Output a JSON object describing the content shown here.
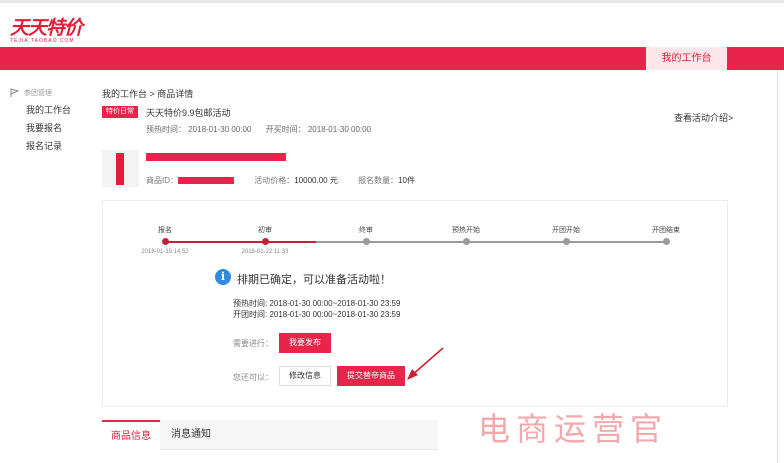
{
  "header": {
    "logo_text": "天天特价",
    "logo_sub": "TEJIA.TAOBAO.COM",
    "workbench_label": "我的工作台"
  },
  "sidebar": {
    "heading": "参团管理",
    "items": [
      {
        "label": "我的工作台"
      },
      {
        "label": "我要报名"
      },
      {
        "label": "报名记录"
      }
    ]
  },
  "breadcrumb": "我的工作台 > 商品详情",
  "activity": {
    "tag": "特价日常",
    "title": "天天特价9.9包邮活动",
    "preheat": "预热时间： 2018-01-30 00:00",
    "open": "开买时间： 2018-01-30 00:00",
    "view_link": "查看活动介绍>"
  },
  "product": {
    "id_label": "商品ID：",
    "price_label": "活动价格：",
    "price": "10000.00 元",
    "qty_label": "报名数量：",
    "qty": "10件"
  },
  "steps": [
    {
      "label": "报名",
      "time": "2018-01-19 14:52",
      "done": true
    },
    {
      "label": "初审",
      "time": "2018-01-22 11:33",
      "done": true
    },
    {
      "label": "终审",
      "time": "",
      "done": false
    },
    {
      "label": "预热开始",
      "time": "",
      "done": false
    },
    {
      "label": "开团开始",
      "time": "",
      "done": false
    },
    {
      "label": "开团结束",
      "time": "",
      "done": false
    }
  ],
  "status": {
    "message": "排期已确定，可以准备活动啦！",
    "preheat_line": "预热时间: 2018-01-30 00:00~2018-01-30 23:59",
    "open_line": "开团时间: 2018-01-30 00:00~2018-01-30 23:59"
  },
  "actions": {
    "need_label": "需要进行：",
    "publish_button": "我要发布",
    "also_label": "您还可以：",
    "edit_button": "修改信息",
    "substitute_button": "提交替帝商品"
  },
  "tabs": [
    {
      "label": "商品信息"
    },
    {
      "label": "消息通知"
    }
  ],
  "watermark": "电商运营官",
  "colors": {
    "brand_red": "#e8244a",
    "workbench_bg": "#fde6ea",
    "info_blue": "#2e8be0",
    "step_done": "#c81e3a",
    "step_pending": "#9a9a9a",
    "arrow_red": "#d01f2c"
  }
}
